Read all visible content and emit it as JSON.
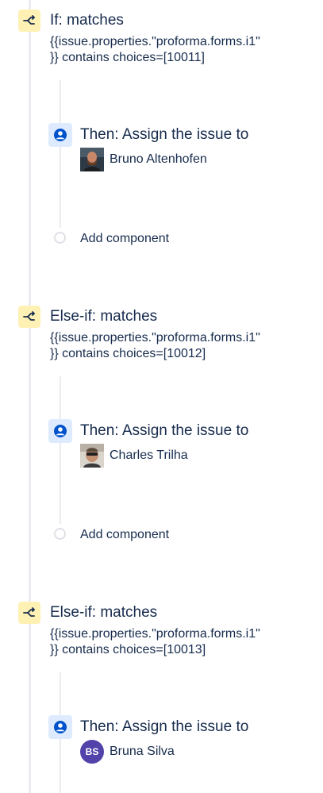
{
  "colors": {
    "condition_icon_bg": "#fff0b3",
    "action_icon_bg": "#deebff",
    "action_icon_fg": "#0052cc",
    "text": "#172b4d",
    "rail": "#ebecf0",
    "initials_avatar_bg": "#5243aa"
  },
  "icons": {
    "condition": "branch-icon",
    "action": "user-circle-icon",
    "add": "empty-circle-icon"
  },
  "branches": [
    {
      "title": "If: matches",
      "expression_line1": "{{issue.properties.\"proforma.forms.i1\"",
      "expression_line2": "}} contains choices=[10011]",
      "action_title": "Then: Assign the issue to",
      "assignee_name": "Bruno Altenhofen",
      "add_component_label": "Add component"
    },
    {
      "title": "Else-if: matches",
      "expression_line1": "{{issue.properties.\"proforma.forms.i1\"",
      "expression_line2": "}} contains choices=[10012]",
      "action_title": "Then: Assign the issue to",
      "assignee_name": "Charles Trilha",
      "add_component_label": "Add component"
    },
    {
      "title": "Else-if: matches",
      "expression_line1": "{{issue.properties.\"proforma.forms.i1\"",
      "expression_line2": "}} contains choices=[10013]",
      "action_title": "Then: Assign the issue to",
      "assignee_name": "Bruna Silva",
      "assignee_initials": "BS"
    }
  ]
}
